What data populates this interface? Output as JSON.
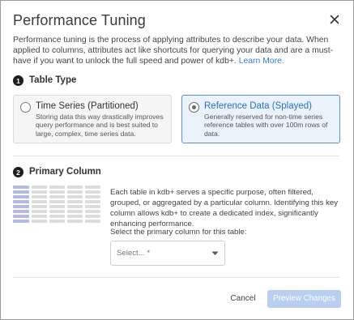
{
  "dialog": {
    "title": "Performance Tuning",
    "close_icon": "close-icon"
  },
  "intro": {
    "text": "Performance tuning is the process of applying attributes to describe your data. When applied to columns, attributes act like shortcuts for querying your data and are a must-have if you want to unlock the full speed and power of kdb+.",
    "learn_more": "Learn More."
  },
  "table_type": {
    "step": "1",
    "title": "Table Type",
    "options": [
      {
        "title": "Time Series (Partitioned)",
        "description": "Storing data this way drastically improves query performance and is best suited to large, complex, time series data.",
        "selected": false
      },
      {
        "title": "Reference Data (Splayed)",
        "description": "Generally reserved for non-time series reference tables with over 100m rows of data.",
        "selected": true
      }
    ]
  },
  "primary_column": {
    "step": "2",
    "title": "Primary Column",
    "description": "Each table in kdb+ serves a specific purpose, often filtered, grouped, or aggregated by a particular column. Identifying this key column allows kdb+ to create a dedicated index, significantly enhancing performance.",
    "select_label": "Select the primary column for this table:",
    "select_placeholder": "Select... *",
    "icon": "table-column-icon"
  },
  "footer": {
    "cancel": "Cancel",
    "preview": "Preview Changes"
  },
  "colors": {
    "accent": "#2f7fd6",
    "selected_card_bg": "#eaf2fc",
    "selected_card_border": "#5e8fd6",
    "highlight_column": "#b3b9e8",
    "disabled_button": "#b8cff0"
  }
}
